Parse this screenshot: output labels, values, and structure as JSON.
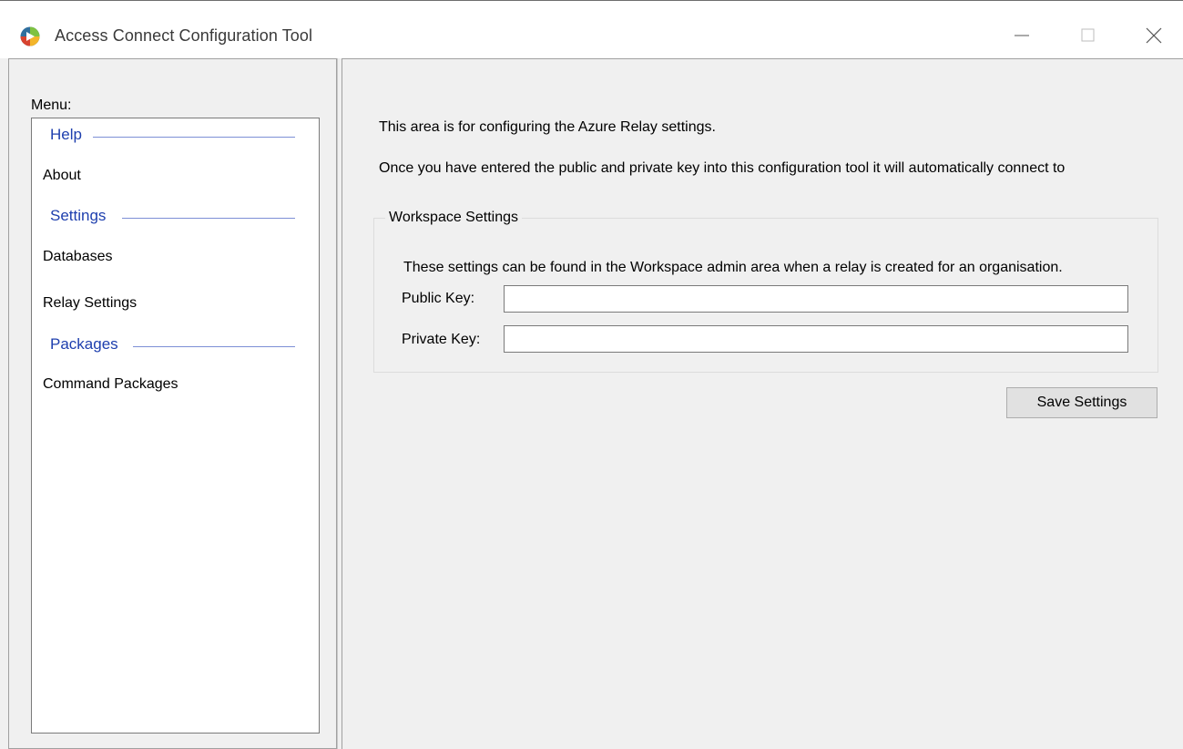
{
  "window": {
    "title": "Access Connect Configuration Tool",
    "icon": "app-logo-icon"
  },
  "sidebar": {
    "menu_label": "Menu:",
    "groups": [
      {
        "label": "Help",
        "items": [
          "About"
        ]
      },
      {
        "label": "Settings",
        "items": [
          "Databases",
          "Relay Settings"
        ]
      },
      {
        "label": "Packages",
        "items": [
          "Command Packages"
        ]
      }
    ]
  },
  "main": {
    "description_line1": "This area is for configuring the Azure Relay settings.",
    "description_line2": "Once you have entered the public and private key into this configuration tool it will automatically connect to",
    "workspace_settings": {
      "title": "Workspace Settings",
      "description": "These settings can be found in the Workspace admin area when a relay is created for an organisation.",
      "public_key_label": "Public Key:",
      "public_key_value": "",
      "private_key_label": "Private Key:",
      "private_key_value": ""
    },
    "save_button_label": "Save Settings"
  },
  "colors": {
    "group_header": "#1e3fae",
    "group_line": "#7d8fd6",
    "window_background": "#f0f0f0"
  }
}
